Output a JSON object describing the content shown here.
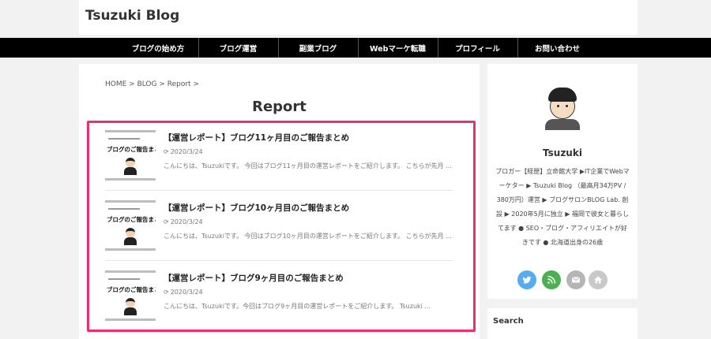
{
  "site": {
    "title": "Tsuzuki Blog"
  },
  "nav": {
    "items": [
      {
        "label": "ブログの始め方"
      },
      {
        "label": "ブログ運営"
      },
      {
        "label": "副業ブログ"
      },
      {
        "label": "Webマーケ転職"
      },
      {
        "label": "プロフィール"
      },
      {
        "label": "お問い合わせ"
      }
    ]
  },
  "breadcrumb": {
    "text": "HOME > BLOG > Report >"
  },
  "page": {
    "title": "Report"
  },
  "posts": [
    {
      "title": "【運営レポート】ブログ11ヶ月目のご報告まとめ",
      "date": "2020/3/24",
      "excerpt": "こんにちは、Tsuzukiです。 今回はブログ11ヶ月目の運営レポートをご紹介します。 こちらが先月 ..."
    },
    {
      "title": "【運営レポート】ブログ10ヶ月目のご報告まとめ",
      "date": "2020/3/24",
      "excerpt": "こんにちは、Tsuzukiです。 今回はブログ10ヶ月目の運営レポートをご紹介します。 こちらが先月 ..."
    },
    {
      "title": "【運営レポート】ブログ9ヶ月目のご報告まとめ",
      "date": "2020/3/24",
      "excerpt": "こんにちは、Tsuzukiです。今回はブログ9ヶ月目の運営レポートをご紹介します。 Tsuzuki ..."
    }
  ],
  "thumbnail": {
    "text": "ブログのご報告まとめ"
  },
  "profile": {
    "name": "Tsuzuki",
    "bio": "ブロガー【経歴】立命館大学 ▶IT企業でWebマーケター ▶ Tsuzuki Blog （最高月34万PV / 380万円）運営 ▶ ブログサロンBLOG Lab. 創設 ▶ 2020年5月に独立 ▶ 福岡で彼女と暮らしてます ● SEO・ブログ・アフィリエイトが好きです ● 北海道出身の26歳"
  },
  "social": [
    {
      "icon": "twitter-icon",
      "color": "#55acee"
    },
    {
      "icon": "rss-icon",
      "color": "#4caf50"
    },
    {
      "icon": "mail-icon",
      "color": "#b5b5b5"
    },
    {
      "icon": "home-icon",
      "color": "#c8c8c8"
    }
  ],
  "sidebar": {
    "search_title": "Search"
  },
  "colors": {
    "highlight": "#ee2d6b",
    "nav_bg": "#000000"
  }
}
